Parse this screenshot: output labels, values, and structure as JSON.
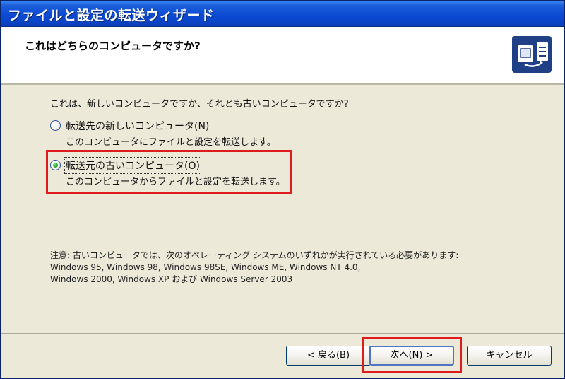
{
  "window": {
    "title": "ファイルと設定の転送ウィザード"
  },
  "header": {
    "heading": "これはどちらのコンピュータですか?",
    "icon": "transfer-wizard-icon"
  },
  "content": {
    "question": "これは、新しいコンピュータですか、それとも古いコンピュータですか?",
    "options": [
      {
        "label": "転送先の新しいコンピュータ(N)",
        "description": "このコンピュータにファイルと設定を転送します。",
        "checked": false
      },
      {
        "label": "転送元の古いコンピュータ(O)",
        "description": "このコンピュータからファイルと設定を転送します。",
        "checked": true
      }
    ],
    "note_line1": "注意: 古いコンピュータでは、次のオペレーティング システムのいずれかが実行されている必要があります:",
    "note_line2": "Windows 95, Windows 98, Windows 98SE, Windows ME, Windows NT 4.0,",
    "note_line3": "Windows 2000, Windows XP および Windows Server 2003"
  },
  "buttons": {
    "back": "< 戻る(B)",
    "next": "次へ(N) >",
    "cancel": "キャンセル"
  },
  "colors": {
    "titlebar": "#0c4bd4",
    "highlight": "#e01b1b",
    "dialog_bg": "#ece9d8"
  }
}
